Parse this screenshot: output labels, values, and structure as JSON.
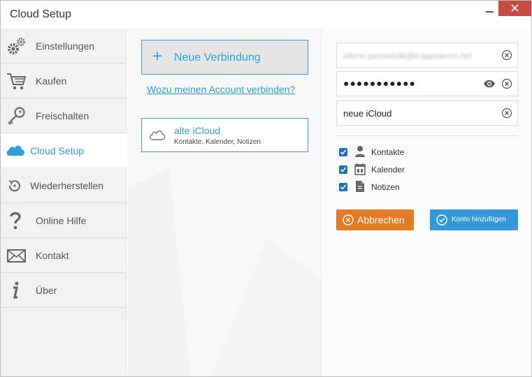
{
  "window": {
    "title": "Cloud Setup",
    "close_color": "#c94a43"
  },
  "sidebar": {
    "items": [
      {
        "label": "Einstellungen",
        "icon": "gears-icon",
        "active": false
      },
      {
        "label": "Kaufen",
        "icon": "shopping-cart-icon",
        "active": false
      },
      {
        "label": "Freischalten",
        "icon": "key-icon",
        "active": false
      },
      {
        "label": "Cloud Setup",
        "icon": "cloud-icon",
        "active": true
      },
      {
        "label": "Wiederherstellen",
        "icon": "restore-icon",
        "active": false
      },
      {
        "label": "Online Hilfe",
        "icon": "question-icon",
        "active": false
      },
      {
        "label": "Kontakt",
        "icon": "envelope-icon",
        "active": false
      },
      {
        "label": "Über",
        "icon": "info-icon",
        "active": false
      }
    ]
  },
  "middle": {
    "new_connection_label": "Neue Verbindung",
    "why_link": "Wozu meinen Account verbinden?",
    "accounts": [
      {
        "name": "alte iCloud",
        "services": "Kontakte, Kalender, Notizen"
      }
    ]
  },
  "form": {
    "email_value": "ellene.pannekökl@icapptakers.net",
    "password_value": "●●●●●●●●●●●",
    "name_value": "neue iCloud",
    "options": [
      {
        "label": "Kontakte",
        "icon": "person-icon",
        "checked": true
      },
      {
        "label": "Kalender",
        "icon": "calendar-icon",
        "checked": true
      },
      {
        "label": "Notizen",
        "icon": "document-icon",
        "checked": true
      }
    ],
    "cancel_label": "Abbrechen",
    "add_label": "Konto hinzufügen"
  },
  "colors": {
    "accent": "#2b9fd9",
    "cancel": "#e27c24",
    "add": "#3399db",
    "checkbox": "#1c6fb8"
  }
}
